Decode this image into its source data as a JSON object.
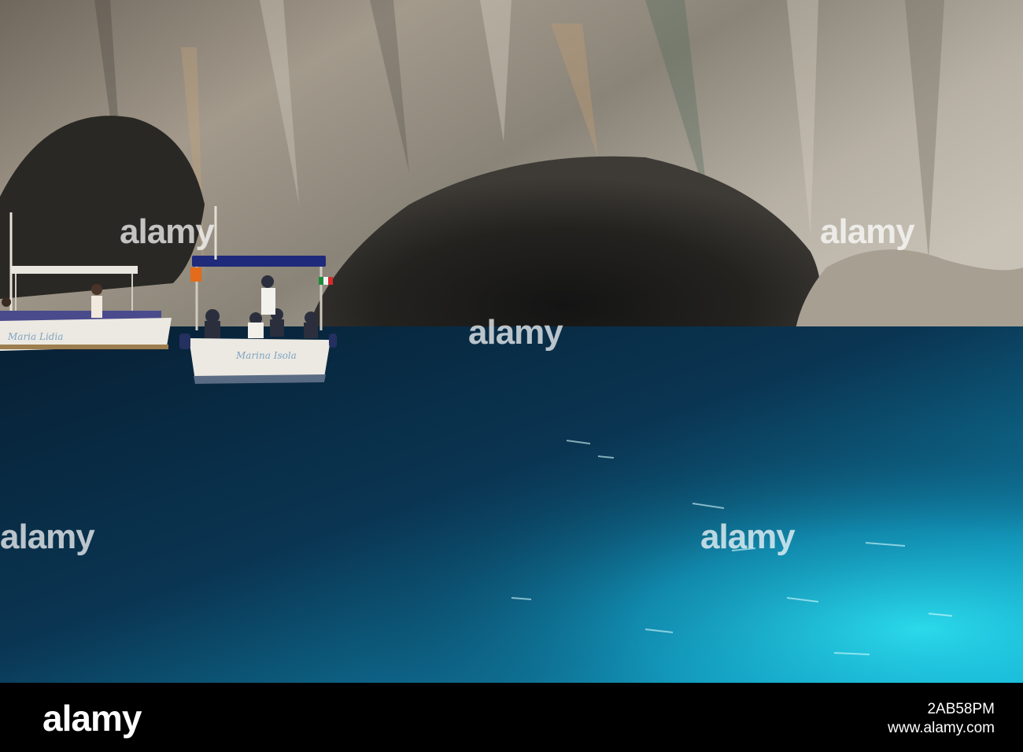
{
  "colors": {
    "rock_light": "#b9b0a3",
    "rock_dark": "#3c3a36",
    "water_deep": "#06263d",
    "water_bright": "#15c7e5",
    "canopy_blue": "#1f2a7a",
    "hull_white": "#ece9e2"
  },
  "scene": {
    "boat_small_name": "Maria Lidia",
    "boat_main_name": "Marina Isola",
    "watermark_text": "alamy"
  },
  "footer": {
    "logo": "alamy",
    "image_id": "2AB58PM",
    "site": "www.alamy.com"
  }
}
